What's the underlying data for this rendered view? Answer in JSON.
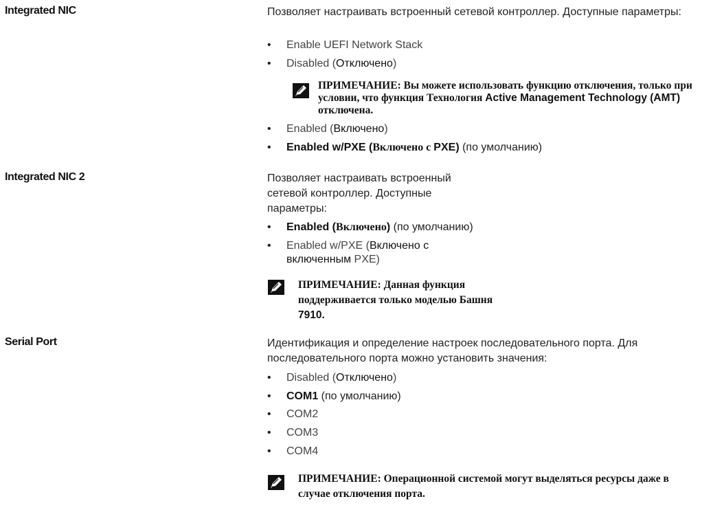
{
  "sections": [
    {
      "label": "Integrated NIC",
      "description": "Позволяет настраивать встроенный сетевой контроллер. Доступные параметры:",
      "options": [
        {
          "name": "Enable UEFI Network Stack",
          "rest": ""
        },
        {
          "name": "Disabled (",
          "translation": "Отключено",
          "rest": ")"
        },
        {
          "name": "Enabled (",
          "translation": "Включено",
          "rest": ")"
        },
        {
          "name_bold": "Enabled w/PXE (",
          "translation_bold": "Включено с ",
          "name_bold2": "PXE)",
          "rest": " (по умолчанию)"
        }
      ],
      "note": {
        "prefix": "ПРИМЕЧАНИЕ: Вы можете использовать функцию отключения, только при условии, что функция Технология ",
        "term": "Active Management Technology (AMT)",
        "suffix": " отключена."
      }
    },
    {
      "label": "Integrated NIC 2",
      "description": "Позволяет настраивать встроенный сетевой контроллер. Доступные параметры:",
      "options": [
        {
          "name_bold": "Enabled (",
          "translation_bold": "Включено",
          "name_bold2": ")",
          "rest": " (по умолчанию)"
        },
        {
          "name": "Enabled w/PXE (",
          "translation": "Включено с включенным",
          "rest": " PXE)"
        }
      ],
      "note": {
        "prefix": "ПРИМЕЧАНИЕ: Данная функция поддерживается только моделью Башня ",
        "term": "7910."
      }
    },
    {
      "label": "Serial Port",
      "description": "Идентификация и определение настроек последовательного порта. Для последовательного порта можно установить значения:",
      "options": [
        {
          "name": "Disabled (",
          "translation": "Отключено",
          "rest": ")"
        },
        {
          "name_bold": "COM1",
          "rest": " (по умолчанию)"
        },
        {
          "name": "COM2"
        },
        {
          "name": "COM3"
        },
        {
          "name": "COM4"
        }
      ],
      "note": {
        "prefix": "ПРИМЕЧАНИЕ: Операционной системой могут выделяться ресурсы даже в случае отключения порта."
      }
    }
  ],
  "icons": {
    "note": "note-pencil-icon"
  }
}
